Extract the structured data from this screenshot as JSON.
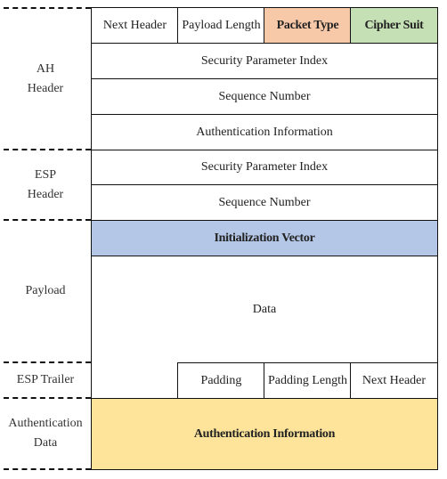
{
  "colors": {
    "packet_type": "#f8c9a9",
    "cipher_suit": "#c5e0b4",
    "iv": "#b4c7e7",
    "auth_data": "#fde49a"
  },
  "sections": {
    "ah": "AH\nHeader",
    "esp": "ESP\nHeader",
    "payload": "Payload",
    "trailer": "ESP Trailer",
    "auth": "Authentication\nData"
  },
  "ah": {
    "next_header": "Next Header",
    "payload_length": "Payload Length",
    "packet_type": "Packet Type",
    "cipher_suit": "Cipher Suit",
    "spi": "Security Parameter Index",
    "seq": "Sequence Number",
    "auth_info": "Authentication Information"
  },
  "esp": {
    "spi": "Security Parameter Index",
    "seq": "Sequence Number"
  },
  "payload": {
    "iv": "Initialization Vector",
    "data": "Data"
  },
  "trailer": {
    "padding": "Padding",
    "padding_length": "Padding Length",
    "next_header": "Next Header"
  },
  "auth_data": {
    "info": "Authentication Information"
  }
}
